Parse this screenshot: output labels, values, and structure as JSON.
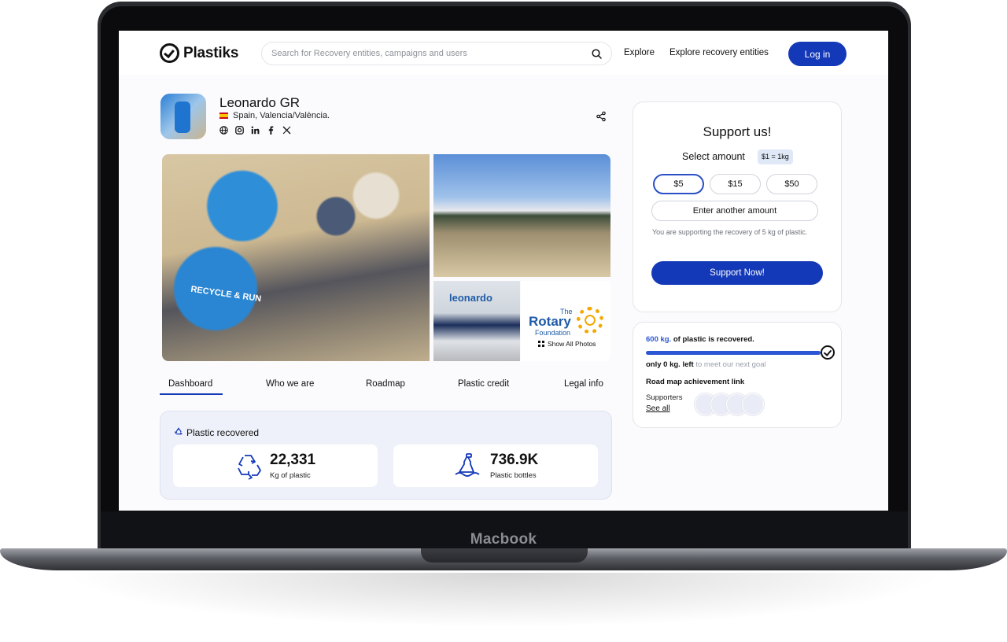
{
  "device": {
    "label": "Macbook"
  },
  "app": {
    "logo_text": "Plastiks"
  },
  "nav": {
    "search_placeholder": "Search for Recovery entities, campaigns and users",
    "explore": "Explore",
    "explore_entities": "Explore recovery entities",
    "login": "Log in"
  },
  "profile": {
    "name": "Leonardo GR",
    "location": "Spain, Valencia/València.",
    "socials": [
      "globe-icon",
      "instagram-icon",
      "linkedin-icon",
      "facebook-icon",
      "x-icon"
    ]
  },
  "gallery": {
    "shirt_text": "RECYCLE & RUN",
    "leonardo_sign": "leonardo",
    "rotary_the": "The",
    "rotary_name": "Rotary",
    "rotary_foundation": "Foundation",
    "show_all": "Show All Photos"
  },
  "tabs": [
    "Dashboard",
    "Who we are",
    "Roadmap",
    "Plastic credit",
    "Legal info"
  ],
  "recovered": {
    "title": "Plastic recovered",
    "stats": [
      {
        "value": "22,331",
        "label": "Kg of plastic",
        "icon": "recycle-icon"
      },
      {
        "value": "736.9K",
        "label": "Plastic bottles",
        "icon": "bottle-icon"
      }
    ]
  },
  "support": {
    "title": "Support us!",
    "select_amount": "Select amount",
    "rate": "$1 = 1kg",
    "amounts": [
      "$5",
      "$15",
      "$50"
    ],
    "selected_amount": "$5",
    "another": "Enter another amount",
    "note": "You are supporting the recovery of 5 kg of plastic.",
    "cta": "Support Now!"
  },
  "progress": {
    "recovered_amount": "600 kg.",
    "recovered_text": " of plastic is recovered.",
    "left_amount": "only 0 kg. left",
    "left_text": " to meet our next goal",
    "fraction": 1.0,
    "roadmap_link": "Road map achievement link",
    "supporters_label": "Supporters",
    "see_all": "See all"
  },
  "colors": {
    "primary": "#1439b8",
    "accent": "#2c57d4",
    "card_bg": "#eef1fa"
  }
}
